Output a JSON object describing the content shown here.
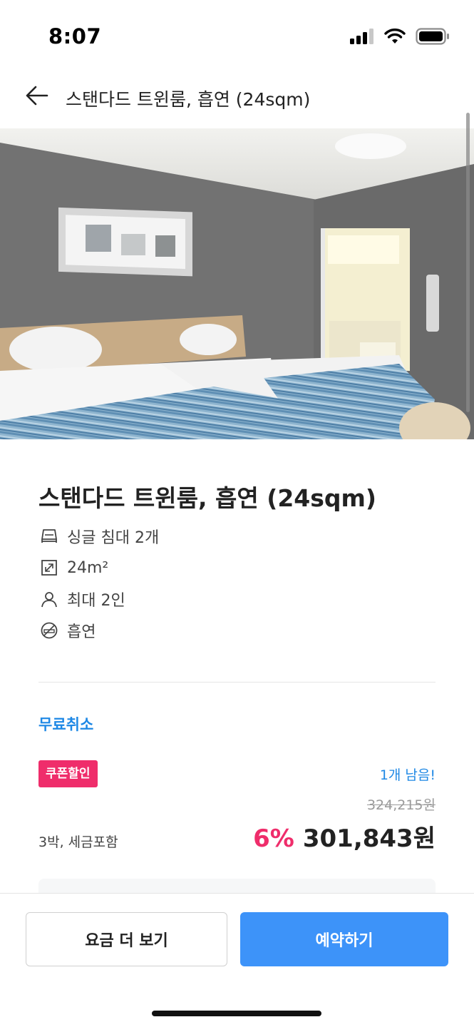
{
  "status_bar": {
    "time": "8:07",
    "icons": [
      "cellular-signal-icon",
      "wifi-icon",
      "battery-icon"
    ]
  },
  "header": {
    "back_icon": "arrow-left-icon",
    "title": "스탠다드 트윈룸, 흡연 (24sqm)"
  },
  "photo": {
    "description_icon": "room-photo"
  },
  "room": {
    "title": "스탠다드 트윈룸, 흡연 (24sqm)",
    "features": [
      {
        "icon": "bed-icon",
        "label": "싱글 침대 2개"
      },
      {
        "icon": "room-size-icon",
        "label": "24m²"
      },
      {
        "icon": "person-icon",
        "label": "최대 2인"
      },
      {
        "icon": "smoking-icon",
        "label": "흡연"
      }
    ]
  },
  "offer": {
    "free_cancel": "무료취소",
    "coupon_badge": "쿠폰할인",
    "rooms_left": "1개 남음!",
    "original_price": "324,215원",
    "stay_info": "3박, 세금포함",
    "discount_rate": "6%",
    "final_price": "301,843원"
  },
  "actions": {
    "more_rates": "요금 더 보기",
    "book": "예약하기"
  },
  "colors": {
    "accent_blue": "#3d93f9",
    "link_blue": "#1e88e5",
    "discount_pink": "#ef2d6b"
  }
}
